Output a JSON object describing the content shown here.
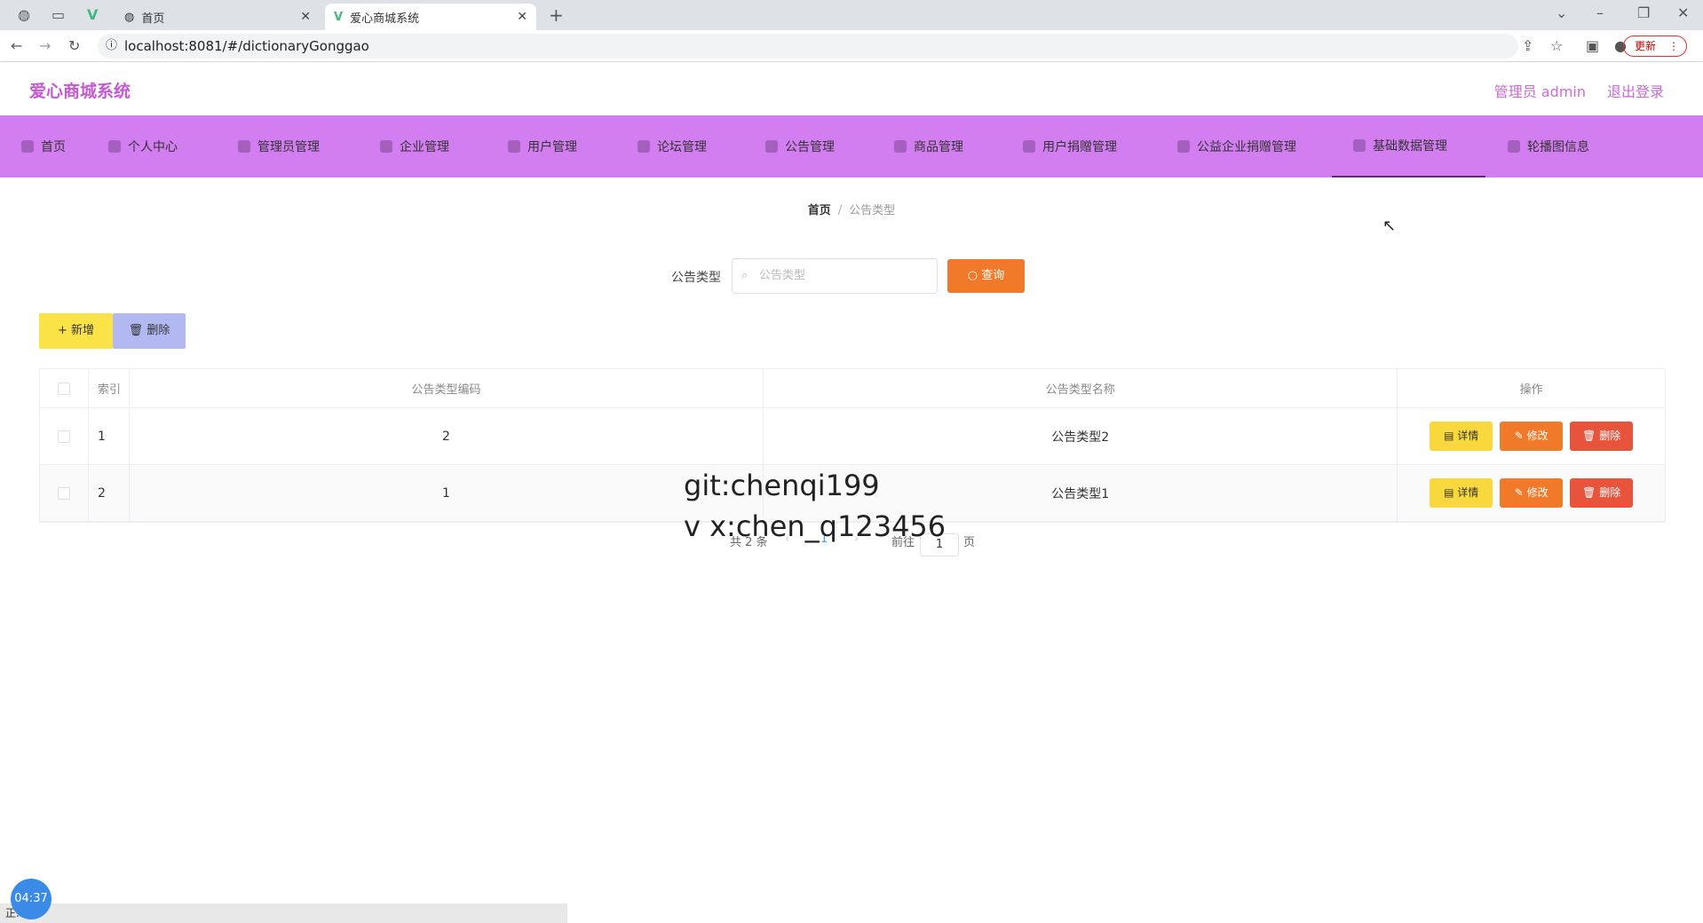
{
  "browser": {
    "tabs": [
      {
        "title": ""
      },
      {
        "title": ""
      },
      {
        "title": "首页"
      },
      {
        "title": "爱心商城系统"
      }
    ],
    "url": "localhost:8081/#/dictionaryGonggao",
    "update_label": "更新"
  },
  "header": {
    "title": "爱心商城系统",
    "admin": "管理员 admin",
    "logout": "退出登录"
  },
  "nav": {
    "items": [
      {
        "label": "首页"
      },
      {
        "label": "个人中心"
      },
      {
        "label": "管理员管理"
      },
      {
        "label": "企业管理"
      },
      {
        "label": "用户管理"
      },
      {
        "label": "论坛管理"
      },
      {
        "label": "公告管理"
      },
      {
        "label": "商品管理"
      },
      {
        "label": "用户捐赠管理"
      },
      {
        "label": "公益企业捐赠管理"
      },
      {
        "label": "基础数据管理"
      },
      {
        "label": "轮播图信息"
      }
    ],
    "active": "基础数据管理"
  },
  "breadcrumb": {
    "home": "首页",
    "separator": "/",
    "current": "公告类型"
  },
  "search": {
    "label": "公告类型",
    "placeholder": "公告类型",
    "query_label": "查询"
  },
  "actions": {
    "add_label": "+ 新增",
    "delete_label": "删除"
  },
  "table": {
    "headers": {
      "index": "索引",
      "code": "公告类型编码",
      "name": "公告类型名称",
      "ops": "操作"
    },
    "rows": [
      {
        "index": "1",
        "code": "2",
        "name": "公告类型2"
      },
      {
        "index": "2",
        "code": "1",
        "name": "公告类型1"
      }
    ],
    "op_labels": {
      "detail": "详情",
      "edit": "修改",
      "delete": "删除"
    }
  },
  "pagination": {
    "total": "共 2 条",
    "current": "1",
    "goto_label": "前往",
    "page_value": "1",
    "page_suffix": "页"
  },
  "watermark": {
    "line1": "git:chenqi199",
    "line2": "v x:chen_q123456"
  },
  "overlay": {
    "timer": "04:37",
    "status": "正..."
  }
}
